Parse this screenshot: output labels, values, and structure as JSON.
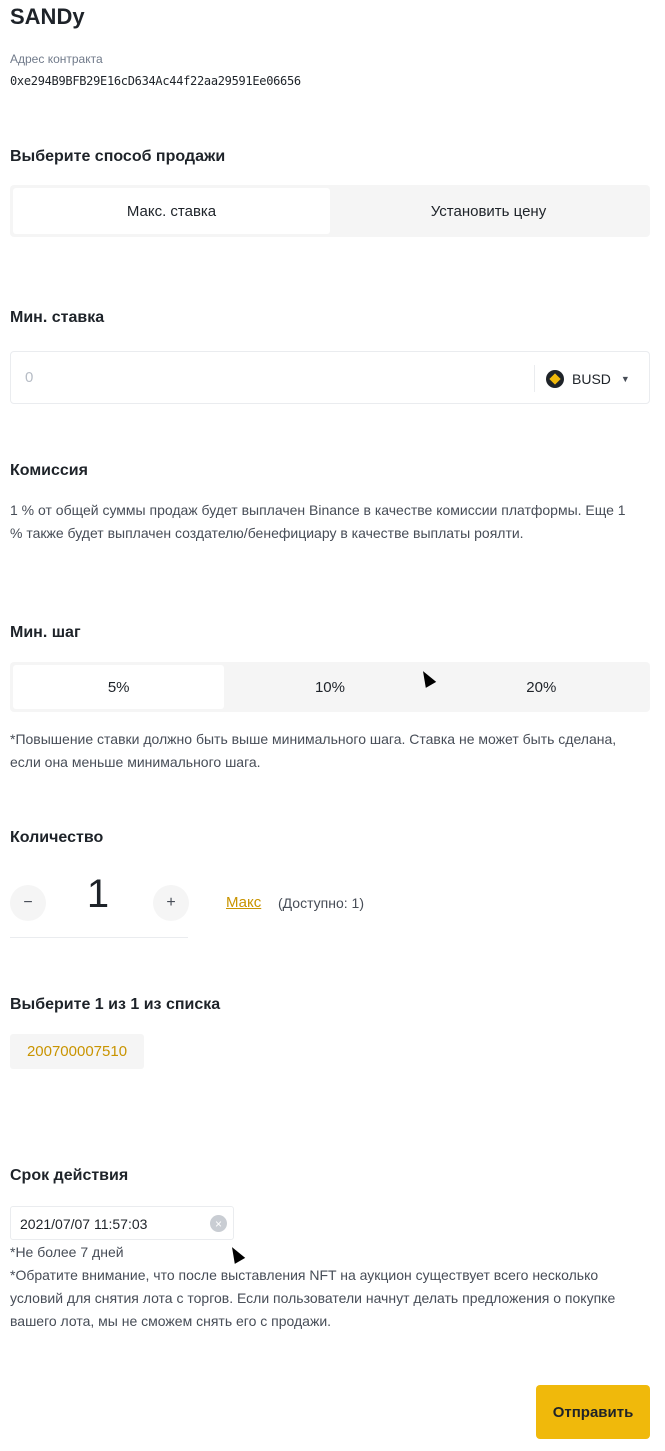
{
  "nft": {
    "title": "SANDy",
    "contract_label": "Адрес контракта",
    "contract_address": "0xe294B9BFB29E16cD634Ac44f22aa29591Ee06656"
  },
  "sale_method": {
    "heading": "Выберите способ продажи",
    "options": [
      "Макс. ставка",
      "Установить цену"
    ],
    "selected": "Макс. ставка"
  },
  "min_bid": {
    "heading": "Мин. ставка",
    "value": "0",
    "currency": "BUSD",
    "currency_icon": "busd-coin-icon"
  },
  "commission": {
    "heading": "Комиссия",
    "text": "1 % от общей суммы продаж будет выплачен Binance в качестве комиссии платформы. Еще 1 % также будет выплачен создателю/бенефициару в качестве выплаты роялти."
  },
  "min_step": {
    "heading": "Мин. шаг",
    "options": [
      "5%",
      "10%",
      "20%"
    ],
    "selected": "5%",
    "note": "*Повышение ставки должно быть выше минимального шага. Ставка не может быть сделана, если она меньше минимального шага."
  },
  "quantity": {
    "heading": "Количество",
    "value": "1",
    "minus": "−",
    "plus": "+",
    "max_label": "Макс",
    "available": "(Доступно: 1)"
  },
  "selection": {
    "heading": "Выберите 1 из 1 из списка",
    "items": [
      "200700007510"
    ]
  },
  "validity": {
    "heading": "Срок действия",
    "datetime": "2021/07/07 11:57:03",
    "note_short": "*Не более 7 дней",
    "note_long": "*Обратите внимание, что после выставления NFT на аукцион существует всего несколько условий для снятия лота с торгов. Если пользователи начнут делать предложения о покупке вашего лота, мы не сможем снять его с продажи."
  },
  "submit_label": "Отправить",
  "colors": {
    "accent": "#f0b90b",
    "link": "#c99400",
    "segment_bg": "#f5f5f5"
  }
}
